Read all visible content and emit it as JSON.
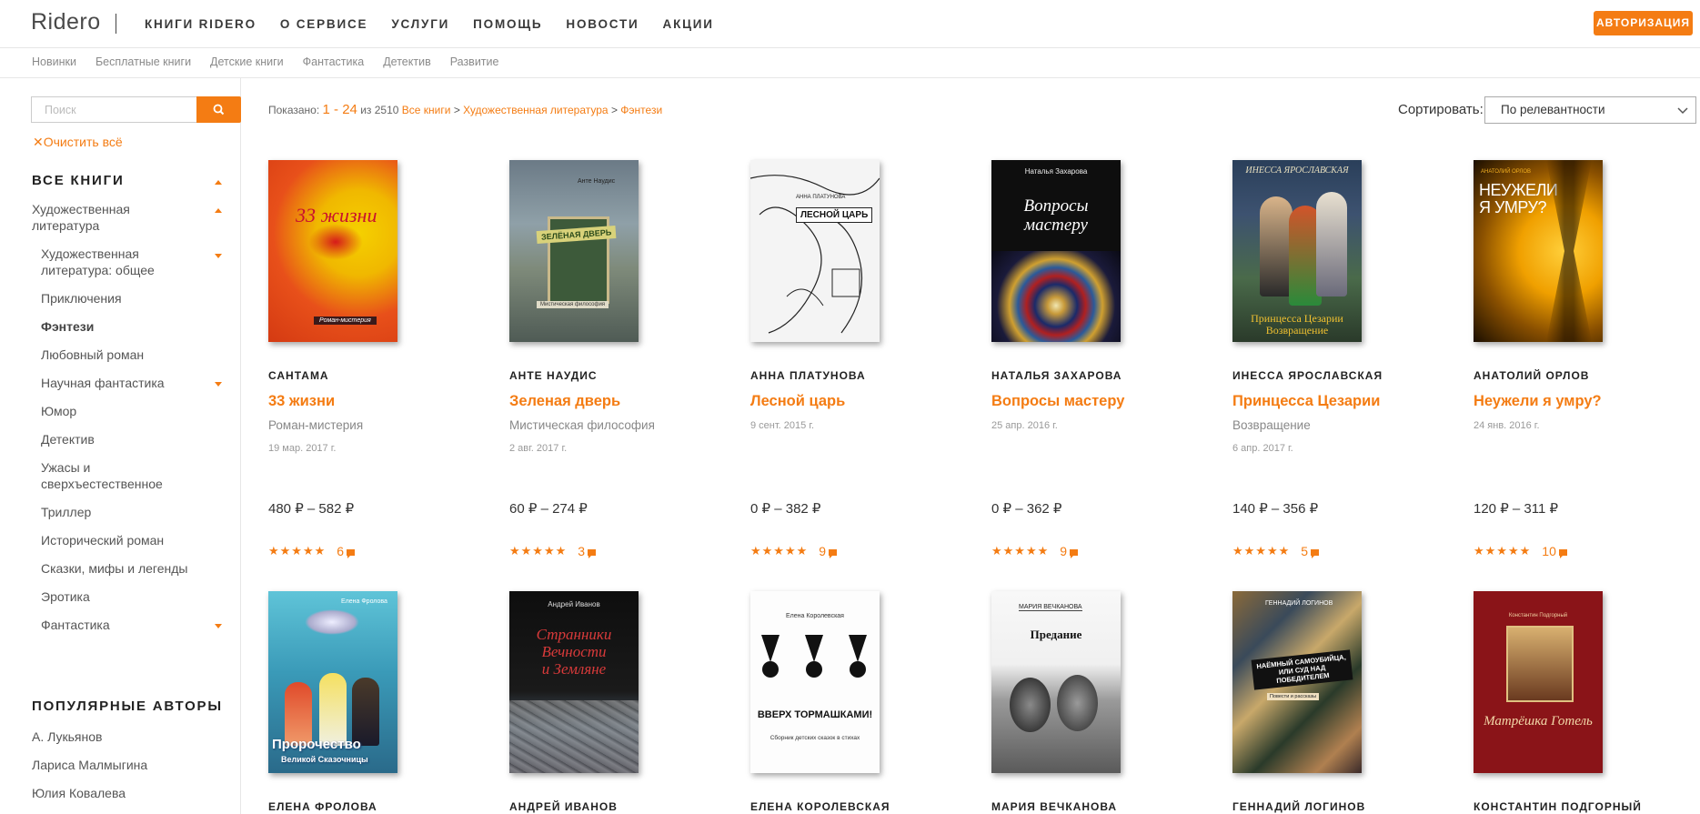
{
  "header": {
    "logo": "Ridero",
    "nav": [
      "КНИГИ RIDERO",
      "О СЕРВИСЕ",
      "УСЛУГИ",
      "ПОМОЩЬ",
      "НОВОСТИ",
      "АКЦИИ"
    ],
    "auth_button": "АВТОРИЗАЦИЯ"
  },
  "subnav": [
    "Новинки",
    "Бесплатные книги",
    "Детские книги",
    "Фантастика",
    "Детектив",
    "Развитие"
  ],
  "sidebar": {
    "search_placeholder": "Поиск",
    "clear_all": "Очистить всё",
    "all_books_title": "ВСЕ КНИГИ",
    "fiction": "Художественная литература",
    "categories": [
      "Художественная литература: общее",
      "Приключения",
      "Фэнтези",
      "Любовный роман",
      "Научная фантастика",
      "Юмор",
      "Детектив",
      "Ужасы и сверхъестественное",
      "Триллер",
      "Исторический роман",
      "Сказки, мифы и легенды",
      "Эротика",
      "Фантастика"
    ],
    "popular_authors_title": "ПОПУЛЯРНЫЕ АВТОРЫ",
    "authors": [
      "А. Лукьянов",
      "Лариса Малмыгина",
      "Юлия Ковалева"
    ]
  },
  "results": {
    "shown_label": "Показано:",
    "range": "1 - 24",
    "of_label": "из 2510",
    "breadcrumb": [
      "Все книги",
      "Художественная литература",
      "Фэнтези"
    ],
    "sort_label": "Сортировать:",
    "sort_value": "По релевантности"
  },
  "books": [
    {
      "author": "САНТАМА",
      "title": "33 жизни",
      "genre": "Роман-мистерия",
      "date": "19 мар. 2017 г.",
      "price": "480 ₽ – 582 ₽",
      "rating": 5,
      "reviews": "6"
    },
    {
      "author": "АНТЕ НАУДИС",
      "title": "Зеленая дверь",
      "genre": "Мистическая философия",
      "date": "2 авг. 2017 г.",
      "price": "60 ₽ – 274 ₽",
      "rating": 5,
      "reviews": "3"
    },
    {
      "author": "АННА ПЛАТУНОВА",
      "title": "Лесной царь",
      "genre": "",
      "date": "9 сент. 2015 г.",
      "price": "0 ₽ – 382 ₽",
      "rating": 5,
      "reviews": "9"
    },
    {
      "author": "НАТАЛЬЯ ЗАХАРОВА",
      "title": "Вопросы мастеру",
      "genre": "",
      "date": "25 апр. 2016 г.",
      "price": "0 ₽ – 362 ₽",
      "rating": 5,
      "reviews": "9"
    },
    {
      "author": "ИНЕССА ЯРОСЛАВСКАЯ",
      "title": "Принцесса Цезарии",
      "genre": "Возвращение",
      "date": "6 апр. 2017 г.",
      "price": "140 ₽ – 356 ₽",
      "rating": 5,
      "reviews": "5"
    },
    {
      "author": "АНАТОЛИЙ ОРЛОВ",
      "title": "Неужели я умру?",
      "genre": "",
      "date": "24 янв. 2016 г.",
      "price": "120 ₽ – 311 ₽",
      "rating": 5,
      "reviews": "10"
    },
    {
      "author": "ЕЛЕНА ФРОЛОВА"
    },
    {
      "author": "АНДРЕЙ ИВАНОВ"
    },
    {
      "author": "ЕЛЕНА КОРОЛЕВСКАЯ"
    },
    {
      "author": "МАРИЯ ВЕЧКАНОВА"
    },
    {
      "author": "ГЕННАДИЙ ЛОГИНОВ"
    },
    {
      "author": "КОНСТАНТИН ПОДГОРНЫЙ"
    }
  ],
  "covers": [
    {
      "line1": "33 жизни",
      "line2": "Роман-мистерия",
      "author": "Сантама"
    },
    {
      "line1": "ЗЕЛЁНАЯ ДВЕРЬ",
      "line2": "Мистическая философия",
      "author": "Анте Наудис"
    },
    {
      "line1": "ЛЕСНОЙ ЦАРЬ",
      "line2": "",
      "author": "АННА ПЛАТУНОВА"
    },
    {
      "line1": "Вопросы",
      "line2": "мастеру",
      "author": "Наталья Захарова"
    },
    {
      "line1": "Принцесса Цезарии",
      "line2": "Возвращение",
      "author": "ИНЕССА ЯРОСЛАВСКАЯ"
    },
    {
      "line1": "НЕУЖЕЛИ",
      "line2": "Я УМРУ?",
      "author": "АНАТОЛИЙ ОРЛОВ"
    },
    {
      "line1": "Пророчество",
      "line2": "Великой Сказочницы",
      "author": "Елена Фролова"
    },
    {
      "line1": "Странники Вечности",
      "line2": "и Земляне",
      "author": "Андрей Иванов"
    },
    {
      "line1": "ВВЕРХ ТОРМАШКАМИ!",
      "line2": "Сборник детских сказок в стихах",
      "author": "Елена Королевская"
    },
    {
      "line1": "Предание",
      "line2": "",
      "author": "МАРИЯ ВЕЧКАНОВА"
    },
    {
      "line1": "НАЁМНЫЙ САМОУБИЙЦА, ИЛИ СУД НАД ПОБЕДИТЕЛЕМ",
      "line2": "Повести и рассказы",
      "author": "ГЕННАДИЙ ЛОГИНОВ"
    },
    {
      "line1": "Матрёшка Готель",
      "line2": "",
      "author": "Константин Подгорный"
    }
  ]
}
